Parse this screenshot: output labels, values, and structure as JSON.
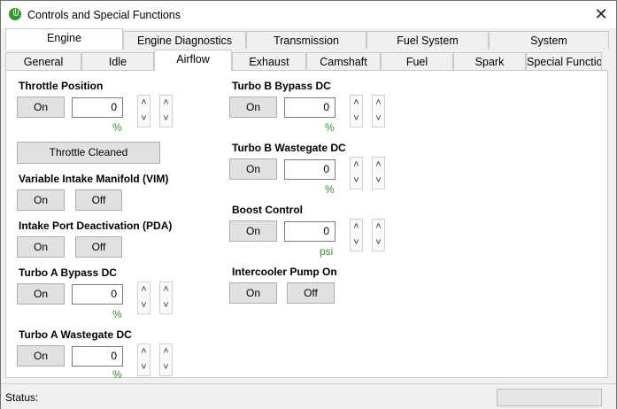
{
  "window": {
    "title": "Controls and Special Functions",
    "close_glyph": "✕"
  },
  "tabs_row1": [
    "Engine",
    "Engine Diagnostics",
    "Transmission",
    "Fuel System",
    "System"
  ],
  "tabs_row2": [
    "General",
    "Idle",
    "Airflow",
    "Exhaust",
    "Camshaft",
    "Fuel",
    "Spark",
    "Special Functio"
  ],
  "active_tab_row1": "Engine",
  "active_tab_row2": "Airflow",
  "controls": {
    "throttle_position": {
      "label": "Throttle Position",
      "on": "On",
      "value": "0",
      "unit": "%"
    },
    "throttle_cleaned": {
      "label": "Throttle Cleaned"
    },
    "vim": {
      "label": "Variable Intake Manifold (VIM)",
      "on": "On",
      "off": "Off"
    },
    "pda": {
      "label": "Intake Port Deactivation (PDA)",
      "on": "On",
      "off": "Off"
    },
    "turbo_a_bypass": {
      "label": "Turbo A Bypass DC",
      "on": "On",
      "value": "0",
      "unit": "%"
    },
    "turbo_a_wastegate": {
      "label": "Turbo A Wastegate DC",
      "on": "On",
      "value": "0",
      "unit": "%"
    },
    "turbo_b_bypass": {
      "label": "Turbo B Bypass DC",
      "on": "On",
      "value": "0",
      "unit": "%"
    },
    "turbo_b_wastegate": {
      "label": "Turbo B Wastegate DC",
      "on": "On",
      "value": "0",
      "unit": "%"
    },
    "boost_control": {
      "label": "Boost Control",
      "on": "On",
      "value": "0",
      "unit": "psi"
    },
    "intercooler_pump": {
      "label": "Intercooler Pump On",
      "on": "On",
      "off": "Off"
    }
  },
  "spin": {
    "up": "˄",
    "down": "˅"
  },
  "status": {
    "label": "Status:",
    "text": ""
  },
  "colors": {
    "unit_green": "#3a8a3a",
    "accent_green": "#2e9a2e"
  },
  "icons": [
    "power-icon",
    "close-icon",
    "spin-up-icon",
    "spin-down-icon"
  ]
}
